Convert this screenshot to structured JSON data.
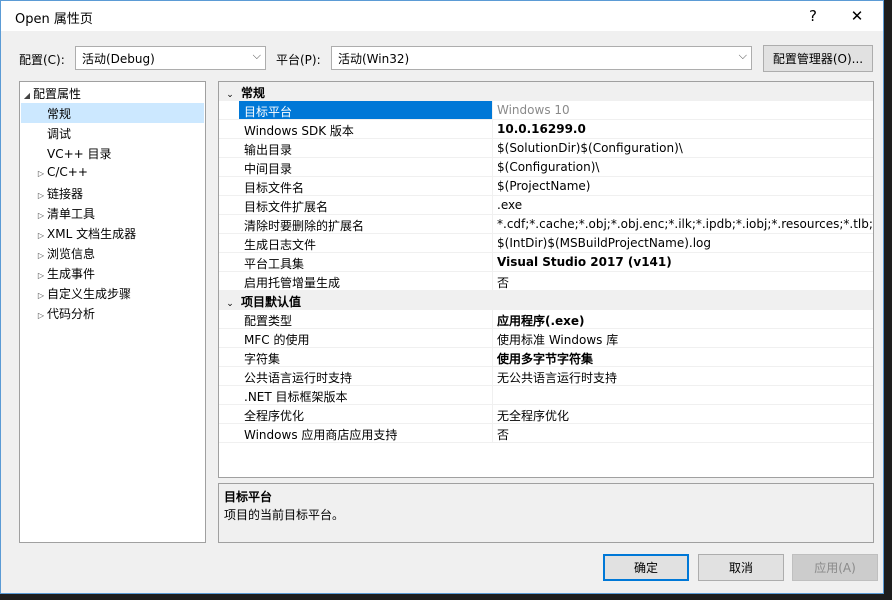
{
  "window": {
    "title": "Open 属性页",
    "help_glyph": "?",
    "close_glyph": "✕"
  },
  "config_bar": {
    "configuration_label": "配置(C):",
    "configuration_value": "活动(Debug)",
    "platform_label": "平台(P):",
    "platform_value": "活动(Win32)",
    "config_manager_button": "配置管理器(O)..."
  },
  "tree": {
    "root": "配置属性",
    "items": [
      {
        "label": "常规",
        "expandable": false,
        "selected": true
      },
      {
        "label": "调试",
        "expandable": false,
        "selected": false
      },
      {
        "label": "VC++ 目录",
        "expandable": false,
        "selected": false
      },
      {
        "label": "C/C++",
        "expandable": true,
        "selected": false
      },
      {
        "label": "链接器",
        "expandable": true,
        "selected": false
      },
      {
        "label": "清单工具",
        "expandable": true,
        "selected": false
      },
      {
        "label": "XML 文档生成器",
        "expandable": true,
        "selected": false
      },
      {
        "label": "浏览信息",
        "expandable": true,
        "selected": false
      },
      {
        "label": "生成事件",
        "expandable": true,
        "selected": false
      },
      {
        "label": "自定义生成步骤",
        "expandable": true,
        "selected": false
      },
      {
        "label": "代码分析",
        "expandable": true,
        "selected": false
      }
    ]
  },
  "grid": {
    "categories": [
      {
        "name": "常规",
        "rows": [
          {
            "name": "目标平台",
            "value": "Windows 10",
            "selected": true,
            "style": "gray"
          },
          {
            "name": "Windows SDK 版本",
            "value": "10.0.16299.0",
            "style": "bold"
          },
          {
            "name": "输出目录",
            "value": "$(SolutionDir)$(Configuration)\\",
            "style": ""
          },
          {
            "name": "中间目录",
            "value": "$(Configuration)\\",
            "style": ""
          },
          {
            "name": "目标文件名",
            "value": "$(ProjectName)",
            "style": ""
          },
          {
            "name": "目标文件扩展名",
            "value": ".exe",
            "style": ""
          },
          {
            "name": "清除时要删除的扩展名",
            "value": "*.cdf;*.cache;*.obj;*.obj.enc;*.ilk;*.ipdb;*.iobj;*.resources;*.tlb;*.tli;*.t",
            "style": ""
          },
          {
            "name": "生成日志文件",
            "value": "$(IntDir)$(MSBuildProjectName).log",
            "style": ""
          },
          {
            "name": "平台工具集",
            "value": "Visual Studio 2017 (v141)",
            "style": "bold"
          },
          {
            "name": "启用托管增量生成",
            "value": "否",
            "style": ""
          }
        ]
      },
      {
        "name": "项目默认值",
        "rows": [
          {
            "name": "配置类型",
            "value": "应用程序(.exe)",
            "style": "bold"
          },
          {
            "name": "MFC 的使用",
            "value": "使用标准 Windows 库",
            "style": ""
          },
          {
            "name": "字符集",
            "value": "使用多字节字符集",
            "style": "bold"
          },
          {
            "name": "公共语言运行时支持",
            "value": "无公共语言运行时支持",
            "style": ""
          },
          {
            "name": ".NET 目标框架版本",
            "value": "",
            "style": ""
          },
          {
            "name": "全程序优化",
            "value": "无全程序优化",
            "style": ""
          },
          {
            "name": "Windows 应用商店应用支持",
            "value": "否",
            "style": ""
          }
        ]
      }
    ]
  },
  "description": {
    "title": "目标平台",
    "text": "项目的当前目标平台。"
  },
  "buttons": {
    "ok": "确定",
    "cancel": "取消",
    "apply": "应用(A)"
  },
  "colors": {
    "accent": "#0078d7",
    "tree_selection": "#cce8ff"
  }
}
